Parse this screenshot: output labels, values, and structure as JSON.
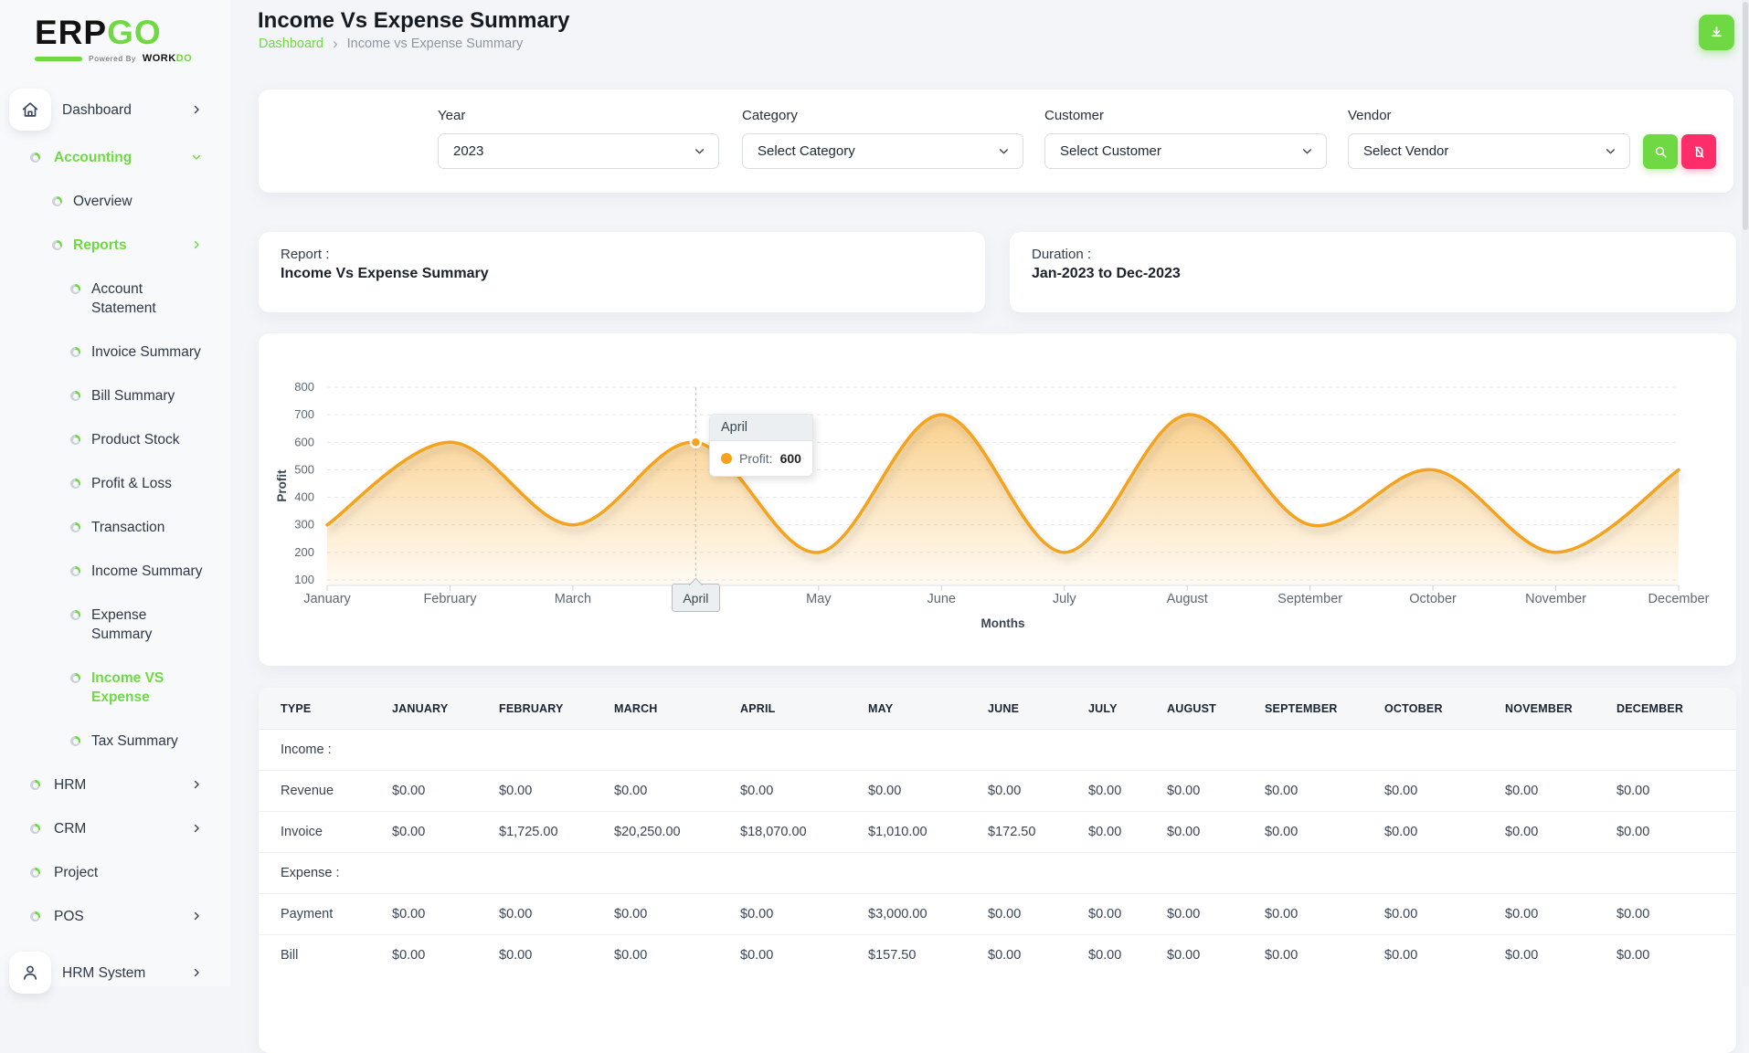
{
  "brand": {
    "erp": "ERP",
    "go": "GO",
    "powered_by": "Powered By",
    "work": "WORK",
    "do": "DO"
  },
  "sidebar": {
    "items": [
      {
        "label": "Dashboard",
        "icon": "home",
        "level": 0,
        "chevron": "right",
        "active": false
      },
      {
        "label": "Accounting",
        "icon": "donut",
        "level": 0,
        "chevron": "down",
        "active": true
      },
      {
        "label": "Overview",
        "icon": "donut",
        "level": 1,
        "chevron": null,
        "active": false
      },
      {
        "label": "Reports",
        "icon": "donut",
        "level": 1,
        "chevron": "right",
        "active": true
      },
      {
        "label": "Account\nStatement",
        "icon": "donut",
        "level": 2,
        "chevron": null,
        "active": false
      },
      {
        "label": "Invoice Summary",
        "icon": "donut",
        "level": 2,
        "chevron": null,
        "active": false
      },
      {
        "label": "Bill Summary",
        "icon": "donut",
        "level": 2,
        "chevron": null,
        "active": false
      },
      {
        "label": "Product Stock",
        "icon": "donut",
        "level": 2,
        "chevron": null,
        "active": false
      },
      {
        "label": "Profit & Loss",
        "icon": "donut",
        "level": 2,
        "chevron": null,
        "active": false
      },
      {
        "label": "Transaction",
        "icon": "donut",
        "level": 2,
        "chevron": null,
        "active": false
      },
      {
        "label": "Income Summary",
        "icon": "donut",
        "level": 2,
        "chevron": null,
        "active": false
      },
      {
        "label": "Expense\nSummary",
        "icon": "donut",
        "level": 2,
        "chevron": null,
        "active": false
      },
      {
        "label": "Income VS\nExpense",
        "icon": "donut",
        "level": 2,
        "chevron": null,
        "active": true
      },
      {
        "label": "Tax Summary",
        "icon": "donut",
        "level": 2,
        "chevron": null,
        "active": false
      },
      {
        "label": "HRM",
        "icon": "donut",
        "level": 0,
        "chevron": "right",
        "active": false
      },
      {
        "label": "CRM",
        "icon": "donut",
        "level": 0,
        "chevron": "right",
        "active": false
      },
      {
        "label": "Project",
        "icon": "donut",
        "level": 0,
        "chevron": null,
        "active": false
      },
      {
        "label": "POS",
        "icon": "donut",
        "level": 0,
        "chevron": "right",
        "active": false
      },
      {
        "label": "HRM System",
        "icon": "user",
        "level": 0,
        "chevron": "right",
        "active": false
      }
    ]
  },
  "header": {
    "title": "Income Vs Expense Summary",
    "breadcrumb": {
      "home": "Dashboard",
      "separator": "›",
      "current": "Income vs Expense Summary"
    }
  },
  "filters": {
    "year": {
      "label": "Year",
      "value": "2023"
    },
    "category": {
      "label": "Category",
      "value": "Select Category"
    },
    "customer": {
      "label": "Customer",
      "value": "Select Customer"
    },
    "vendor": {
      "label": "Vendor",
      "value": "Select Vendor"
    }
  },
  "report_card": {
    "label": "Report :",
    "value": "Income Vs Expense Summary"
  },
  "duration_card": {
    "label": "Duration :",
    "value": "Jan-2023 to Dec-2023"
  },
  "chart_data": {
    "type": "area",
    "curve": "smooth",
    "categories": [
      "January",
      "February",
      "March",
      "April",
      "May",
      "June",
      "July",
      "August",
      "September",
      "October",
      "November",
      "December"
    ],
    "series": [
      {
        "name": "Profit",
        "values": [
          300,
          600,
          300,
          600,
          200,
          700,
          200,
          700,
          300,
          500,
          200,
          500
        ]
      }
    ],
    "xlabel": "Months",
    "ylabel": "Profit",
    "ylim": [
      100,
      800
    ],
    "ytick_step": 100,
    "grid": "horizontal-dashed",
    "legend": "none",
    "line_color": "#f5a21c",
    "tooltip": {
      "category": "April",
      "label": "Profit:",
      "value": "600"
    }
  },
  "table": {
    "headers": [
      "TYPE",
      "JANUARY",
      "FEBRUARY",
      "MARCH",
      "APRIL",
      "MAY",
      "JUNE",
      "JULY",
      "AUGUST",
      "SEPTEMBER",
      "OCTOBER",
      "NOVEMBER",
      "DECEMBER"
    ],
    "rows": [
      {
        "type": "section",
        "label": "Income :"
      },
      {
        "type": "data",
        "label": "Revenue",
        "values": [
          "$0.00",
          "$0.00",
          "$0.00",
          "$0.00",
          "$0.00",
          "$0.00",
          "$0.00",
          "$0.00",
          "$0.00",
          "$0.00",
          "$0.00",
          "$0.00"
        ]
      },
      {
        "type": "data",
        "label": "Invoice",
        "values": [
          "$0.00",
          "$1,725.00",
          "$20,250.00",
          "$18,070.00",
          "$1,010.00",
          "$172.50",
          "$0.00",
          "$0.00",
          "$0.00",
          "$0.00",
          "$0.00",
          "$0.00"
        ]
      },
      {
        "type": "section",
        "label": "Expense :"
      },
      {
        "type": "data",
        "label": "Payment",
        "values": [
          "$0.00",
          "$0.00",
          "$0.00",
          "$0.00",
          "$3,000.00",
          "$0.00",
          "$0.00",
          "$0.00",
          "$0.00",
          "$0.00",
          "$0.00",
          "$0.00"
        ]
      },
      {
        "type": "data",
        "label": "Bill",
        "values": [
          "$0.00",
          "$0.00",
          "$0.00",
          "$0.00",
          "$157.50",
          "$0.00",
          "$0.00",
          "$0.00",
          "$0.00",
          "$0.00",
          "$0.00",
          "$0.00"
        ]
      }
    ]
  },
  "icons": [
    "home-icon",
    "bullet-icon",
    "user-icon",
    "chevron-right-icon",
    "chevron-down-icon",
    "download-icon",
    "search-icon",
    "clear-filter-icon"
  ],
  "colors": {
    "primary_green": "#6fd943",
    "danger_pink": "#fc2d68",
    "chart_orange": "#f5a21c",
    "link_green": "#6fd943"
  }
}
